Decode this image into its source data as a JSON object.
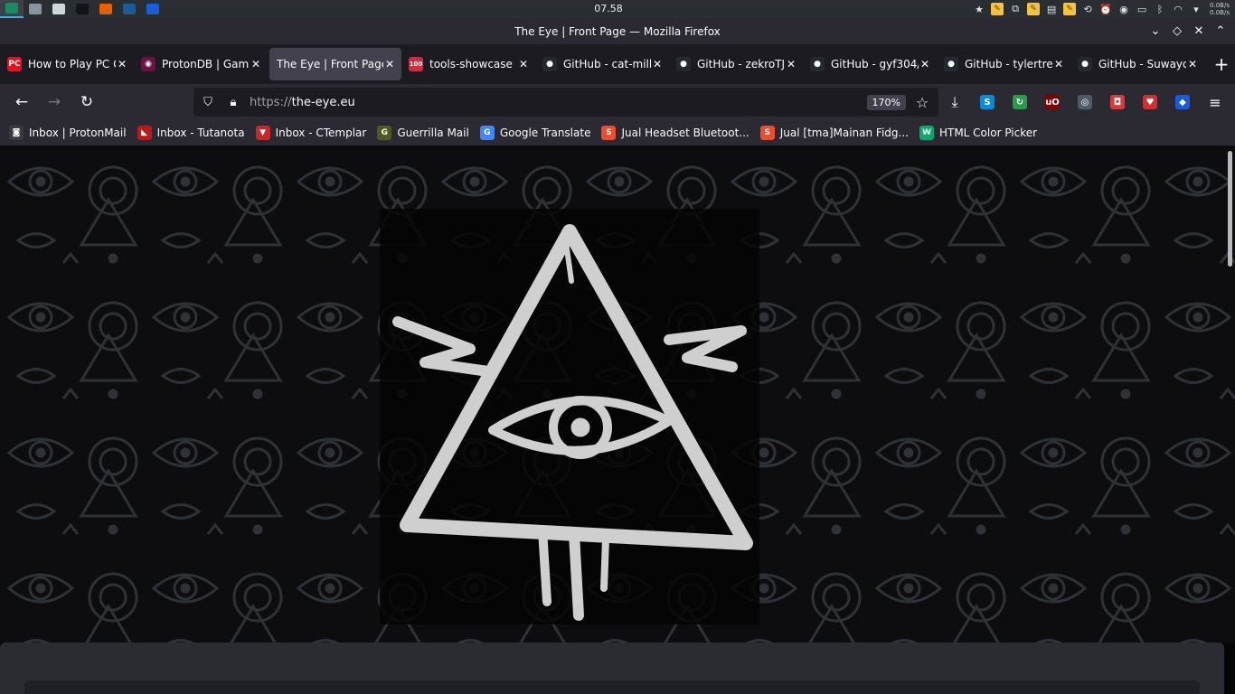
{
  "system": {
    "clock": "07.58",
    "net_up": "0.0B/s",
    "net_down": "0.0B/s",
    "apps": [
      {
        "name": "taskbar-app-1",
        "color": "#1a8a63"
      },
      {
        "name": "taskbar-app-2",
        "color": "#8a93a0"
      },
      {
        "name": "taskbar-app-files",
        "color": "#cfd8dc"
      },
      {
        "name": "taskbar-app-terminal",
        "color": "#11151a"
      },
      {
        "name": "taskbar-app-firefox",
        "color": "#e66000"
      },
      {
        "name": "taskbar-app-steam",
        "color": "#1b5c96"
      },
      {
        "name": "taskbar-app-bitwarden",
        "color": "#175ddc"
      }
    ]
  },
  "window": {
    "title": "The Eye | Front Page — Mozilla Firefox"
  },
  "tabs": [
    {
      "label": "How to Play PC G",
      "icon": "pcgamer-icon",
      "icon_text": "PC",
      "icon_color": "#e4111e",
      "selected": false
    },
    {
      "label": "ProtonDB | Gami",
      "icon": "protondb-icon",
      "icon_text": "◉",
      "icon_color": "#6a1245",
      "selected": false
    },
    {
      "label": "The Eye | Front Page",
      "icon": "",
      "icon_text": "",
      "icon_color": "",
      "selected": true
    },
    {
      "label": "tools-showcase",
      "icon": "hundred-icon",
      "icon_text": "100",
      "icon_color": "#d6293a",
      "selected": false
    },
    {
      "label": "GitHub - cat-milk",
      "icon": "github-icon",
      "icon_text": "●",
      "icon_color": "#24292f",
      "selected": false
    },
    {
      "label": "GitHub - zekroTJ",
      "icon": "github-icon",
      "icon_text": "●",
      "icon_color": "#24292f",
      "selected": false
    },
    {
      "label": "GitHub - gyf304/",
      "icon": "github-icon",
      "icon_text": "●",
      "icon_color": "#24292f",
      "selected": false
    },
    {
      "label": "GitHub - tylertrea",
      "icon": "github-icon",
      "icon_text": "●",
      "icon_color": "#24292f",
      "selected": false
    },
    {
      "label": "GitHub - Suwayon",
      "icon": "github-icon",
      "icon_text": "●",
      "icon_color": "#24292f",
      "selected": false
    }
  ],
  "nav": {
    "url_scheme": "https://",
    "url_host": "the-eye.eu",
    "zoom": "170%"
  },
  "extensions": [
    {
      "name": "downloads-icon",
      "glyph": "⤓",
      "color": "transparent"
    },
    {
      "name": "skype-extension-icon",
      "glyph": "S",
      "color": "#0a8bd9"
    },
    {
      "name": "refresh-extension-icon",
      "glyph": "↻",
      "color": "#2b9a4a"
    },
    {
      "name": "ublock-origin-icon",
      "glyph": "uO",
      "color": "#800000"
    },
    {
      "name": "privacy-badger-icon",
      "glyph": "◎",
      "color": "#4c5b66"
    },
    {
      "name": "screenshot-extension-icon",
      "glyph": "◘",
      "color": "#d83a3a"
    },
    {
      "name": "youtube-extension-icon",
      "glyph": "♥",
      "color": "#d32f2f"
    },
    {
      "name": "bitwarden-extension-icon",
      "glyph": "◆",
      "color": "#175ddc"
    },
    {
      "name": "menu-icon",
      "glyph": "≡",
      "color": "transparent"
    }
  ],
  "bookmarks": [
    {
      "label": "Inbox | ProtonMail",
      "icon": "protonmail-icon",
      "glyph": "◙",
      "color": "#3a3a40"
    },
    {
      "label": "Inbox - Tutanota",
      "icon": "tutanota-icon",
      "glyph": "◣",
      "color": "#b71c1c"
    },
    {
      "label": "Inbox - CTemplar",
      "icon": "ctemplar-icon",
      "glyph": "▼",
      "color": "#c62828"
    },
    {
      "label": "Guerrilla Mail",
      "icon": "guerrillamail-icon",
      "glyph": "G",
      "color": "#4d5b22"
    },
    {
      "label": "Google Translate",
      "icon": "google-translate-icon",
      "glyph": "G",
      "color": "#4285f4"
    },
    {
      "label": "Jual Headset Bluetoot...",
      "icon": "shopee-icon",
      "glyph": "S",
      "color": "#ee4d2d"
    },
    {
      "label": "Jual [tma]Mainan Fidg...",
      "icon": "shopee-icon",
      "glyph": "S",
      "color": "#ee4d2d"
    },
    {
      "label": "HTML Color Picker",
      "icon": "w3schools-icon",
      "glyph": "W",
      "color": "#04aa6d"
    }
  ]
}
